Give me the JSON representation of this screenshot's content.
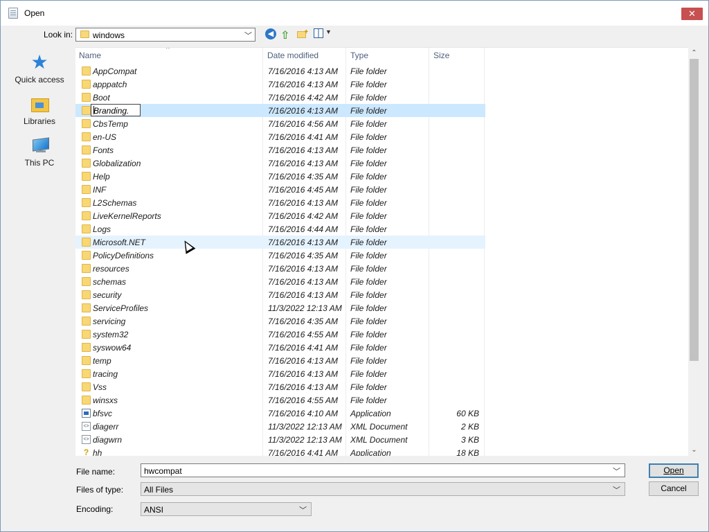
{
  "window": {
    "title": "Open",
    "close_label": "✕"
  },
  "toolbar": {
    "look_in_label": "Look in:",
    "look_in_value": "windows",
    "icons": [
      "back-icon",
      "up-folder-icon",
      "new-folder-icon",
      "view-menu-icon"
    ]
  },
  "places": [
    {
      "label": "Quick access",
      "icon": "star-icon"
    },
    {
      "label": "Libraries",
      "icon": "libraries-icon"
    },
    {
      "label": "This PC",
      "icon": "computer-icon"
    }
  ],
  "columns": {
    "name": "Name",
    "date": "Date modified",
    "type": "Type",
    "size": "Size"
  },
  "rows": [
    {
      "name": "AppCompat",
      "date": "7/16/2016 4:13 AM",
      "type": "File folder",
      "size": "",
      "icon": "folder"
    },
    {
      "name": "apppatch",
      "date": "7/16/2016 4:13 AM",
      "type": "File folder",
      "size": "",
      "icon": "folder"
    },
    {
      "name": "Boot",
      "date": "7/16/2016 4:42 AM",
      "type": "File folder",
      "size": "",
      "icon": "folder"
    },
    {
      "name": "Branding.",
      "date": "7/16/2016 4:13 AM",
      "type": "File folder",
      "size": "",
      "icon": "folder"
    },
    {
      "name": "CbsTemp",
      "date": "7/16/2016 4:56 AM",
      "type": "File folder",
      "size": "",
      "icon": "folder"
    },
    {
      "name": "en-US",
      "date": "7/16/2016 4:41 AM",
      "type": "File folder",
      "size": "",
      "icon": "folder"
    },
    {
      "name": "Fonts",
      "date": "7/16/2016 4:13 AM",
      "type": "File folder",
      "size": "",
      "icon": "folder"
    },
    {
      "name": "Globalization",
      "date": "7/16/2016 4:13 AM",
      "type": "File folder",
      "size": "",
      "icon": "folder"
    },
    {
      "name": "Help",
      "date": "7/16/2016 4:35 AM",
      "type": "File folder",
      "size": "",
      "icon": "folder"
    },
    {
      "name": "INF",
      "date": "7/16/2016 4:45 AM",
      "type": "File folder",
      "size": "",
      "icon": "folder"
    },
    {
      "name": "L2Schemas",
      "date": "7/16/2016 4:13 AM",
      "type": "File folder",
      "size": "",
      "icon": "folder"
    },
    {
      "name": "LiveKernelReports",
      "date": "7/16/2016 4:42 AM",
      "type": "File folder",
      "size": "",
      "icon": "folder"
    },
    {
      "name": "Logs",
      "date": "7/16/2016 4:44 AM",
      "type": "File folder",
      "size": "",
      "icon": "folder"
    },
    {
      "name": "Microsoft.NET",
      "date": "7/16/2016 4:13 AM",
      "type": "File folder",
      "size": "",
      "icon": "folder"
    },
    {
      "name": "PolicyDefinitions",
      "date": "7/16/2016 4:35 AM",
      "type": "File folder",
      "size": "",
      "icon": "folder"
    },
    {
      "name": "resources",
      "date": "7/16/2016 4:13 AM",
      "type": "File folder",
      "size": "",
      "icon": "folder"
    },
    {
      "name": "schemas",
      "date": "7/16/2016 4:13 AM",
      "type": "File folder",
      "size": "",
      "icon": "folder"
    },
    {
      "name": "security",
      "date": "7/16/2016 4:13 AM",
      "type": "File folder",
      "size": "",
      "icon": "folder"
    },
    {
      "name": "ServiceProfiles",
      "date": "11/3/2022 12:13 AM",
      "type": "File folder",
      "size": "",
      "icon": "folder"
    },
    {
      "name": "servicing",
      "date": "7/16/2016 4:35 AM",
      "type": "File folder",
      "size": "",
      "icon": "folder"
    },
    {
      "name": "system32",
      "date": "7/16/2016 4:55 AM",
      "type": "File folder",
      "size": "",
      "icon": "folder"
    },
    {
      "name": "syswow64",
      "date": "7/16/2016 4:41 AM",
      "type": "File folder",
      "size": "",
      "icon": "folder"
    },
    {
      "name": "temp",
      "date": "7/16/2016 4:13 AM",
      "type": "File folder",
      "size": "",
      "icon": "folder"
    },
    {
      "name": "tracing",
      "date": "7/16/2016 4:13 AM",
      "type": "File folder",
      "size": "",
      "icon": "folder"
    },
    {
      "name": "Vss",
      "date": "7/16/2016 4:13 AM",
      "type": "File folder",
      "size": "",
      "icon": "folder"
    },
    {
      "name": "winsxs",
      "date": "7/16/2016 4:55 AM",
      "type": "File folder",
      "size": "",
      "icon": "folder"
    },
    {
      "name": "bfsvc",
      "date": "7/16/2016 4:10 AM",
      "type": "Application",
      "size": "60 KB",
      "icon": "application"
    },
    {
      "name": "diagerr",
      "date": "11/3/2022 12:13 AM",
      "type": "XML Document",
      "size": "2 KB",
      "icon": "xml"
    },
    {
      "name": "diagwrn",
      "date": "11/3/2022 12:13 AM",
      "type": "XML Document",
      "size": "3 KB",
      "icon": "xml"
    },
    {
      "name": "hh",
      "date": "7/16/2016 4:41 AM",
      "type": "Application",
      "size": "18 KB",
      "icon": "help-app"
    }
  ],
  "selected_row": "Branding.",
  "hover_row": "Microsoft.NET",
  "form": {
    "file_name_label": "File name:",
    "file_name_value": "hwcompat",
    "file_type_label": "Files of type:",
    "file_type_value": "All Files",
    "encoding_label": "Encoding:",
    "encoding_value": "ANSI",
    "open_label": "Open",
    "cancel_label": "Cancel"
  },
  "colors": {
    "selection": "#cce8ff",
    "hover": "#e5f3ff",
    "close_button": "#c75050",
    "folder": "#f8d775"
  }
}
